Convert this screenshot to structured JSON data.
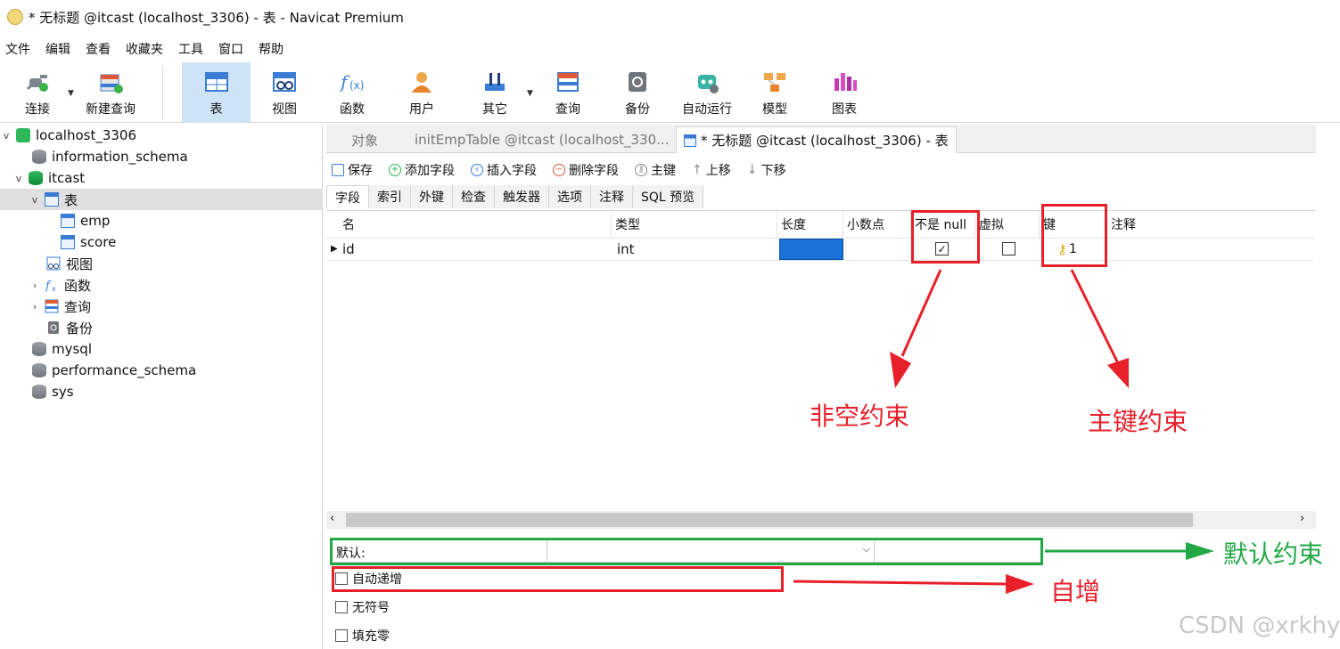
{
  "window": {
    "title": "* 无标题 @itcast (localhost_3306) - 表 - Navicat Premium"
  },
  "menu": [
    "文件",
    "编辑",
    "查看",
    "收藏夹",
    "工具",
    "窗口",
    "帮助"
  ],
  "toolbar": {
    "connect": "连接",
    "new_query": "新建查询",
    "table": "表",
    "view": "视图",
    "function": "函数",
    "user": "用户",
    "other": "其它",
    "query": "查询",
    "backup": "备份",
    "autorun": "自动运行",
    "model": "模型",
    "chart": "图表"
  },
  "sidebar": {
    "conn": "localhost_3306",
    "info_schema": "information_schema",
    "itcast": "itcast",
    "tables": "表",
    "emp": "emp",
    "score": "score",
    "views": "视图",
    "functions": "函数",
    "queries": "查询",
    "backups": "备份",
    "mysql": "mysql",
    "perf": "performance_schema",
    "sys": "sys"
  },
  "tabs": {
    "objects": "对象",
    "tab1": "initEmpTable @itcast (localhost_330...",
    "tab2": "* 无标题 @itcast (localhost_3306) - 表"
  },
  "field_tools": {
    "save": "保存",
    "add": "添加字段",
    "insert": "插入字段",
    "delete": "删除字段",
    "pk": "主键",
    "up": "上移",
    "down": "下移"
  },
  "subtabs": [
    "字段",
    "索引",
    "外键",
    "检查",
    "触发器",
    "选项",
    "注释",
    "SQL 预览"
  ],
  "grid": {
    "headers": {
      "name": "名",
      "type": "类型",
      "length": "长度",
      "decimals": "小数点",
      "not_null": "不是 null",
      "virtual": "虚拟",
      "key": "键",
      "comment": "注释"
    },
    "row": {
      "name": "id",
      "type": "int",
      "not_null": "✓",
      "key": "1"
    }
  },
  "bottom": {
    "default_label": "默认:",
    "auto_inc": "自动递增",
    "unsigned": "无符号",
    "zerofill": "填充零"
  },
  "annotations": {
    "not_null": "非空约束",
    "primary_key": "主键约束",
    "default": "默认约束",
    "auto_inc": "自增"
  },
  "watermark": "CSDN @xrkhy",
  "colors": {
    "annotation_red": "#e8202a",
    "annotation_green": "#22a845",
    "selected_cell": "#1a73d9"
  }
}
